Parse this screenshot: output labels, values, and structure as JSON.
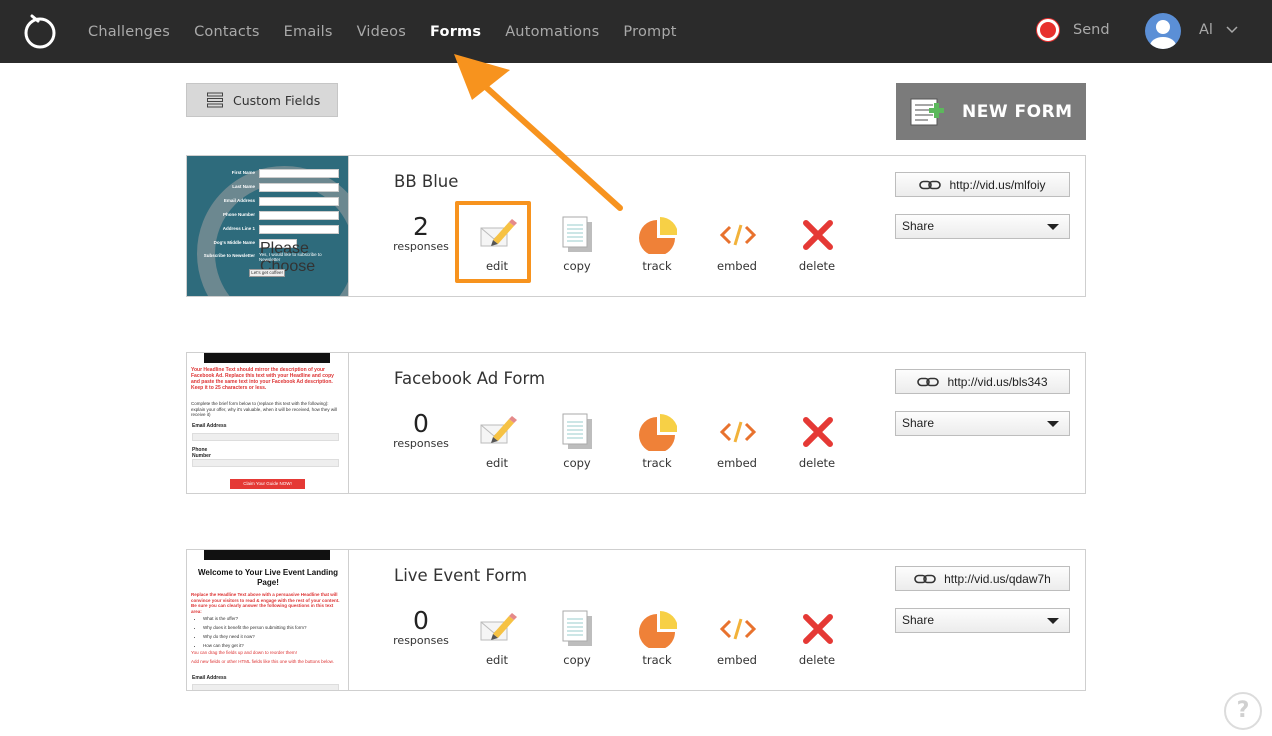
{
  "nav": {
    "items": [
      "Challenges",
      "Contacts",
      "Emails",
      "Videos",
      "Forms",
      "Automations",
      "Prompt"
    ],
    "active": "Forms",
    "send_label": "Send",
    "user_name": "Al"
  },
  "toolbar": {
    "custom_fields_label": "Custom Fields",
    "new_form_label": "NEW FORM"
  },
  "forms": [
    {
      "title": "BB Blue",
      "responses_count": "2",
      "responses_label": "responses",
      "url": "http://vid.us/mlfoiy",
      "share_label": "Share"
    },
    {
      "title": "Facebook Ad Form",
      "responses_count": "0",
      "responses_label": "responses",
      "url": "http://vid.us/bls343",
      "share_label": "Share"
    },
    {
      "title": "Live Event Form",
      "responses_count": "0",
      "responses_label": "responses",
      "url": "http://vid.us/qdaw7h",
      "share_label": "Share"
    }
  ],
  "actions": {
    "edit": "edit",
    "copy": "copy",
    "track": "track",
    "embed": "embed",
    "delete": "delete"
  },
  "thumb1": {
    "first_name": "First Name",
    "last_name": "Last Name",
    "email": "Email Address",
    "phone": "Phone Number",
    "address": "Address Line 1",
    "dog": "Dog's Middle Name",
    "choose": "Please Choose",
    "subscribe": "Subscribe to Newsletter",
    "subscribe_opt": "Yes, I would like to subscribe to Newsletter",
    "button": "Let's get coffee!"
  },
  "thumb2": {
    "headline": "Your Headline Text should mirror the description of your Facebook Ad. Replace this text with your Headline and copy and paste the same text into your Facebook Ad description. Keep it to 25 characters or less.",
    "body": "Complete the brief form below to (replace this text with the following): explain your offer, why it's valuable, when it will be received, how they will receive it)",
    "email_label": "Email Address",
    "phone_label": "Phone Number",
    "cta": "Claim Your Guide NOW!"
  },
  "thumb3": {
    "title": "Welcome to Your Live Event Landing Page!",
    "intro": "Replace the Headline Text above with a persuasive Headline that will convince your visitors to read & engage with the rest of your content. Be sure you can clearly answer the following questions in this text area:",
    "bullets": [
      "What is the offer?",
      "Why does it benefit the person submitting this form?",
      "Why do they need it now?",
      "How can they get it?"
    ],
    "note1": "You can drag the fields up and down to reorder them!",
    "note2": "Add new fields or other HTML fields like this one with the buttons below.",
    "email_label": "Email Address"
  },
  "colors": {
    "topbar": "#2b2b2b",
    "accent_orange": "#f7931e",
    "send_red": "#e8302e",
    "delete_red": "#e53935"
  },
  "icons": {
    "logo": "bomb-circle-logo",
    "send": "record-icon",
    "user": "user-avatar-icon",
    "custom_fields": "list-icon",
    "new_form": "add-form-icon",
    "link": "link-icon",
    "help": "question-icon"
  }
}
